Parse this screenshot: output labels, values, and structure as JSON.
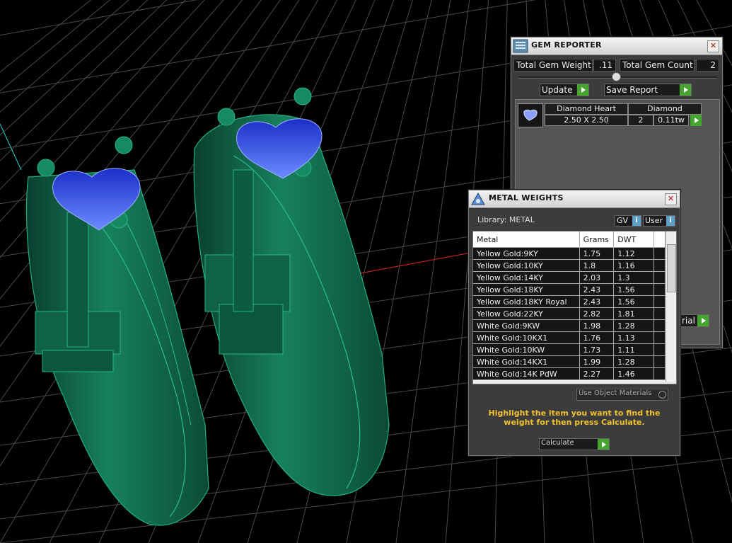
{
  "gem_reporter": {
    "title": "GEM REPORTER",
    "total_weight_label": "Total Gem Weight",
    "total_weight_value": ".11",
    "total_count_label": "Total Gem Count",
    "total_count_value": "2",
    "update_label": "Update",
    "save_report_label": "Save Report",
    "gem": {
      "name": "Diamond Heart",
      "material": "Diamond",
      "size": "2.50 X 2.50",
      "count": "2",
      "weight": "0.11tw"
    },
    "partial_label": "rial"
  },
  "metal_weights": {
    "title": "METAL WEIGHTS",
    "library_label": "Library: METAL",
    "gv_label": "GV",
    "user_label": "User",
    "columns": [
      "Metal",
      "Grams",
      "DWT"
    ],
    "rows": [
      [
        "Yellow Gold:9KY",
        "1.75",
        "1.12"
      ],
      [
        "Yellow Gold:10KY",
        "1.8",
        "1.16"
      ],
      [
        "Yellow Gold:14KY",
        "2.03",
        "1.3"
      ],
      [
        "Yellow Gold:18KY",
        "2.43",
        "1.56"
      ],
      [
        "Yellow Gold:18KY Royal",
        "2.43",
        "1.56"
      ],
      [
        "Yellow Gold:22KY",
        "2.82",
        "1.81"
      ],
      [
        "White Gold:9KW",
        "1.98",
        "1.28"
      ],
      [
        "White Gold:10KX1",
        "1.76",
        "1.13"
      ],
      [
        "White Gold:10KW",
        "1.73",
        "1.11"
      ],
      [
        "White Gold:14KX1",
        "1.99",
        "1.28"
      ],
      [
        "White Gold:14K PdW",
        "2.27",
        "1.46"
      ]
    ],
    "use_object_materials_label": "Use Object Materials",
    "instruction": "Highlight the item you want to find the weight for then press Calculate.",
    "calculate_label": "Calculate"
  },
  "colors": {
    "ring": "#0f5f46",
    "gem": "#2f4fe0",
    "panel": "#3c3c3c",
    "accent_green": "#45a52f",
    "instruction_text": "#f2c12e"
  }
}
